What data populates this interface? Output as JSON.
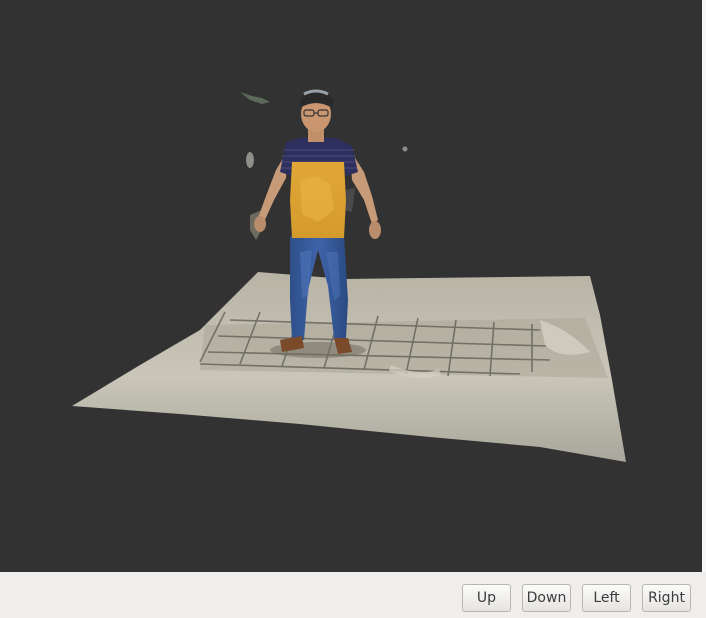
{
  "viewport": {
    "background_color": "#323232",
    "scene": "3D reconstructed point cloud of a person standing on a scanned floor surface"
  },
  "toolbar": {
    "up_label": "Up",
    "down_label": "Down",
    "left_label": "Left",
    "right_label": "Right"
  }
}
